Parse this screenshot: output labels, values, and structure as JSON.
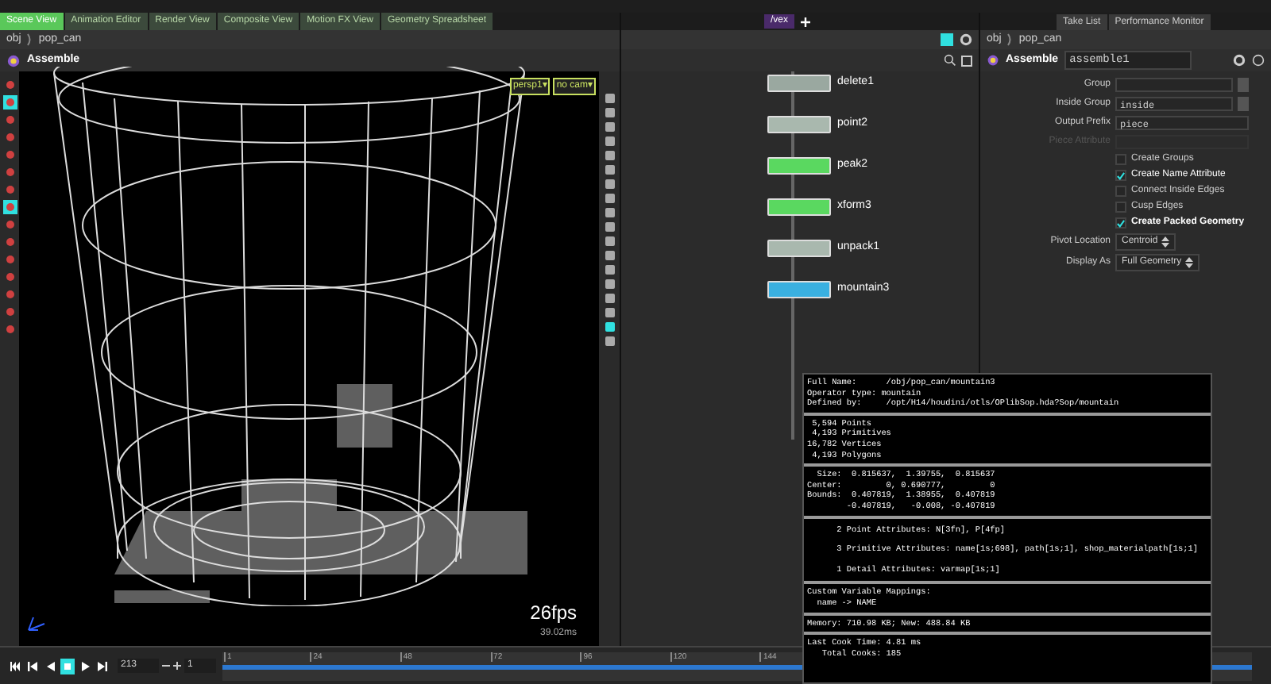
{
  "left_tabs": [
    {
      "label": "Scene View",
      "selected": true
    },
    {
      "label": "Animation Editor",
      "selected": false
    },
    {
      "label": "Render View",
      "selected": false
    },
    {
      "label": "Composite View",
      "selected": false
    },
    {
      "label": "Motion FX View",
      "selected": false
    },
    {
      "label": "Geometry Spreadsheet",
      "selected": false
    }
  ],
  "middle_tab": {
    "label": "/vex"
  },
  "right_tabs": [
    {
      "label": "Take List",
      "selected": false
    },
    {
      "label": "Performance Monitor",
      "selected": false
    }
  ],
  "viewport_path": [
    "obj",
    "pop_can"
  ],
  "viewport_title": "Assemble",
  "camera_menus": [
    "persp1▾",
    "no cam▾"
  ],
  "left_tools": [
    {
      "selected": false
    },
    {
      "selected": true
    },
    {
      "selected": false
    },
    {
      "selected": false
    },
    {
      "selected": false
    },
    {
      "selected": false
    },
    {
      "selected": false
    },
    {
      "selected": true
    },
    {
      "selected": false
    },
    {
      "selected": false
    },
    {
      "selected": false
    },
    {
      "selected": false
    },
    {
      "selected": false
    },
    {
      "selected": false
    },
    {
      "selected": false
    }
  ],
  "fps": "26fps",
  "frame_time": "39.02ms",
  "nodes": [
    {
      "name": "delete1",
      "color": "#9aa8a0"
    },
    {
      "name": "point2",
      "color": "#a9b8ae"
    },
    {
      "name": "peak2",
      "color": "#5ad860"
    },
    {
      "name": "xform3",
      "color": "#5ad860"
    },
    {
      "name": "unpack1",
      "color": "#a9b8ae"
    },
    {
      "name": "mountain3",
      "color": "#3ab0e0"
    }
  ],
  "params_path": [
    "obj",
    "pop_can"
  ],
  "params_header": {
    "type": "Assemble",
    "name": "assemble1"
  },
  "fields": [
    {
      "label": "Group",
      "disabled": false,
      "menu": true
    },
    {
      "label": "Inside Group",
      "value": "inside",
      "disabled": false,
      "menu": true
    },
    {
      "label": "Output Prefix",
      "value": "piece",
      "disabled": false,
      "menu": false
    },
    {
      "label": "Piece Attribute",
      "disabled": true,
      "menu": false
    }
  ],
  "checkboxes": [
    {
      "label": "Create Groups",
      "checked": false
    },
    {
      "label": "Create Name Attribute",
      "checked": true
    },
    {
      "label": "Connect Inside Edges",
      "checked": false
    },
    {
      "label": "Cusp Edges",
      "checked": false
    },
    {
      "label": "Create Packed Geometry",
      "checked": true
    }
  ],
  "dropdowns": [
    {
      "label": "Pivot Location",
      "value": "Centroid"
    },
    {
      "label": "Display As",
      "value": "Full Geometry"
    }
  ],
  "info_sections": [
    [
      "Full Name:      /obj/pop_can/mountain3",
      "Operator type: mountain",
      "Defined by:     /opt/H14/houdini/otls/OPlibSop.hda?Sop/mountain"
    ],
    [
      " 5,594 Points",
      " 4,193 Primitives",
      "16,782 Vertices",
      " 4,193 Polygons"
    ],
    [
      "  Size:  0.815637,  1.39755,  0.815637",
      "Center:         0, 0.690777,         0",
      "Bounds:  0.407819,  1.38955,  0.407819",
      "        -0.407819,   -0.008, -0.407819"
    ],
    [
      "      2 Point Attributes: N[3fn], P[4fp]",
      "      3 Primitive Attributes: name[1s;698], path[1s;1], shop_materialpath[1s;1]",
      "      1 Detail Attributes: varmap[1s;1]"
    ],
    [
      "Custom Variable Mappings:",
      "  name -> NAME"
    ],
    [
      "Memory: 710.98 KB; New: 488.84 KB"
    ],
    [
      "Last Cook Time: 4.81 ms",
      "   Total Cooks: 185"
    ]
  ],
  "playbar": {
    "frame": "213",
    "step": "1"
  },
  "timeline_ticks": [
    "1",
    "24",
    "48",
    "72",
    "96",
    "120",
    "144"
  ]
}
